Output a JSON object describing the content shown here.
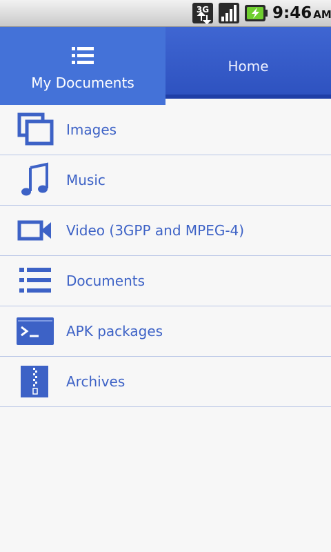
{
  "status_bar": {
    "network_type": "3G",
    "time": "9:46",
    "ampm": "AM",
    "icons": [
      "network-3g-icon",
      "signal-strength-icon",
      "battery-charging-icon"
    ]
  },
  "tabs": [
    {
      "label": "My Documents",
      "icon": "list-icon",
      "selected": true
    },
    {
      "label": "Home",
      "selected": false
    }
  ],
  "items": [
    {
      "label": "Images",
      "icon": "images-icon"
    },
    {
      "label": "Music",
      "icon": "music-note-icon"
    },
    {
      "label": "Video  (3GPP and MPEG-4)",
      "icon": "video-camera-icon"
    },
    {
      "label": "Documents",
      "icon": "document-list-icon"
    },
    {
      "label": "APK packages",
      "icon": "terminal-icon"
    },
    {
      "label": "Archives",
      "icon": "zip-archive-icon"
    }
  ],
  "colors": {
    "accent": "#4472d8",
    "tab_inactive": "#2e52c0",
    "item_text": "#3d62c6",
    "divider": "#b9c6e6",
    "background": "#f7f7f7"
  }
}
